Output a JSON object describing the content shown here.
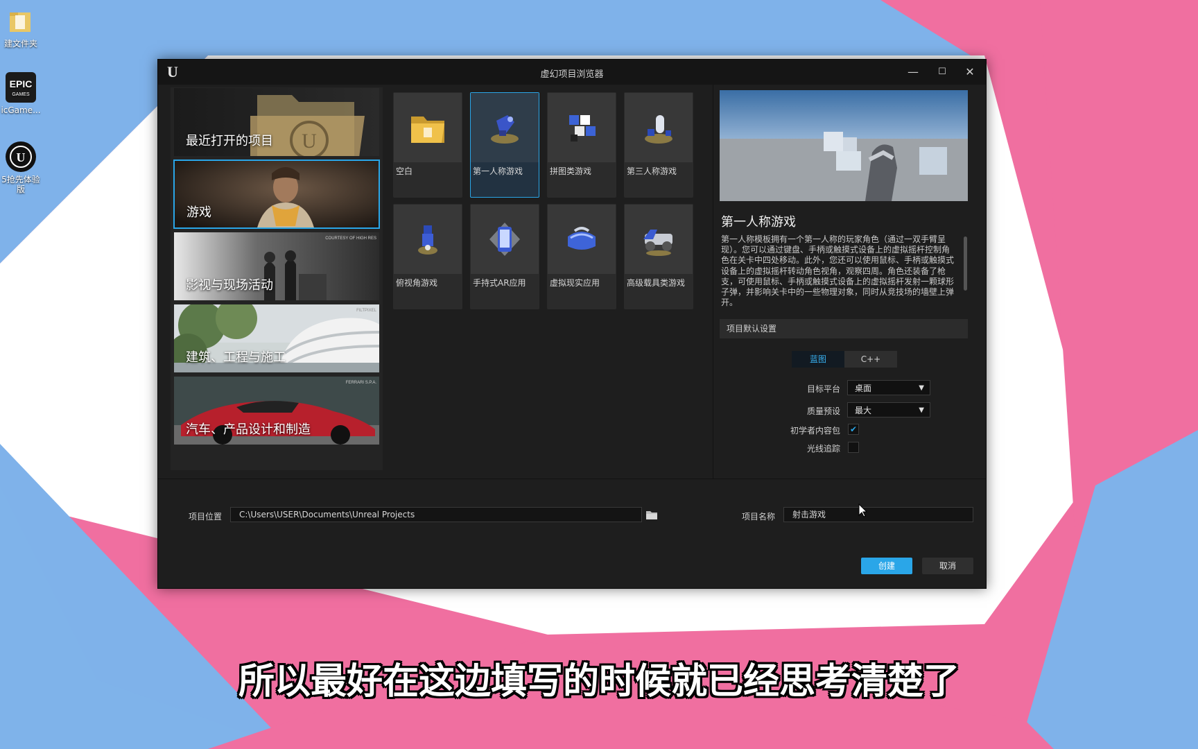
{
  "desktop": {
    "icons": [
      {
        "name": "folder-icon",
        "label": "建文件夹"
      },
      {
        "name": "epic-games-icon",
        "label": "icGame..."
      },
      {
        "name": "unreal-icon",
        "label": "5抢先体验\n版"
      }
    ]
  },
  "window": {
    "title": "虚幻项目浏览器",
    "controls": {
      "minimize": "—",
      "maximize": "☐",
      "close": "✕"
    }
  },
  "categories": [
    {
      "label": "最近打开的项目",
      "selected": false
    },
    {
      "label": "游戏",
      "selected": true
    },
    {
      "label": "影视与现场活动",
      "selected": false
    },
    {
      "label": "建筑、工程与施工",
      "selected": false
    },
    {
      "label": "汽车、产品设计和制造",
      "selected": false
    }
  ],
  "category_watermarks": {
    "film": "COURTESY OF HIGH RES",
    "arch": "FILTPIXEL",
    "auto": "FERRARI S.P.A."
  },
  "templates": [
    {
      "label": "空白",
      "icon": "blank-folder-icon",
      "selected": false
    },
    {
      "label": "第一人称游戏",
      "icon": "first-person-icon",
      "selected": true
    },
    {
      "label": "拼图类游戏",
      "icon": "puzzle-icon",
      "selected": false
    },
    {
      "label": "第三人称游戏",
      "icon": "third-person-icon",
      "selected": false
    },
    {
      "label": "俯视角游戏",
      "icon": "top-down-icon",
      "selected": false
    },
    {
      "label": "手持式AR应用",
      "icon": "handheld-ar-icon",
      "selected": false
    },
    {
      "label": "虚拟现实应用",
      "icon": "vr-headset-icon",
      "selected": false
    },
    {
      "label": "高级载具类游戏",
      "icon": "vehicle-icon",
      "selected": false
    }
  ],
  "details": {
    "title": "第一人称游戏",
    "description": "第一人称模板拥有一个第一人称的玩家角色（通过一双手臂呈现）。您可以通过键盘、手柄或触摸式设备上的虚拟摇杆控制角色在关卡中四处移动。此外，您还可以使用鼠标、手柄或触摸式设备上的虚拟摇杆转动角色视角，观察四周。角色还装备了枪支，可使用鼠标、手柄或触摸式设备上的虚拟摇杆发射一颗球形子弹，并影响关卡中的一些物理对象，同时从竞技场的墙壁上弹开。",
    "section_title": "项目默认设置",
    "code_options": [
      "蓝图",
      "C++"
    ],
    "code_selected": "蓝图",
    "settings": {
      "target_platform_label": "目标平台",
      "target_platform_value": "桌面",
      "quality_label": "质量预设",
      "quality_value": "最大",
      "starter_content_label": "初学者内容包",
      "starter_content_checked": true,
      "raytracing_label": "光线追踪",
      "raytracing_checked": false
    }
  },
  "footer": {
    "location_label": "项目位置",
    "location_value": "C:\\Users\\USER\\Documents\\Unreal Projects",
    "name_label": "项目名称",
    "name_value": "射击游戏",
    "create_label": "创建",
    "cancel_label": "取消"
  },
  "subtitle": "所以最好在这边填写的时候就已经思考清楚了",
  "colors": {
    "accent": "#2aa6e8",
    "create_button": "#2aa6e8",
    "window_bg": "#1e1e1e",
    "wallpaper_pink": "#f06fa0",
    "wallpaper_blue": "#7fb2ea"
  }
}
